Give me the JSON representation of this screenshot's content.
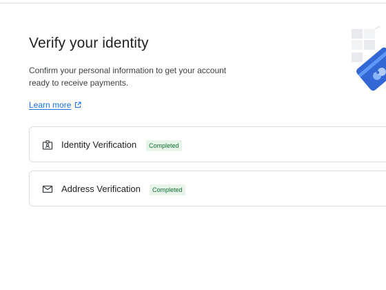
{
  "header": {
    "title": "Verify your identity",
    "description": "Confirm your personal information to get your account ready to receive payments.",
    "learn_more": "Learn more"
  },
  "steps": [
    {
      "label": "Identity Verification",
      "status": "Completed",
      "icon": "id-card-icon"
    },
    {
      "label": "Address Verification",
      "status": "Completed",
      "icon": "envelope-icon"
    }
  ],
  "colors": {
    "link": "#1a73e8",
    "badge_bg": "#e6f4ea",
    "badge_text": "#137333",
    "illustration_blue": "#3367d6"
  }
}
